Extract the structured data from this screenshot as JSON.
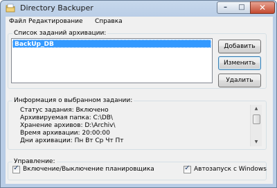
{
  "window": {
    "title": "Directory Backuper",
    "minimize_glyph": "–",
    "maximize_glyph": "□",
    "close_glyph": "✕"
  },
  "menu": {
    "items": [
      {
        "label": "Файл"
      },
      {
        "label": "Редактирование"
      },
      {
        "label": "Справка"
      }
    ]
  },
  "jobs_group": {
    "label": "Список заданий архивации:",
    "items": [
      {
        "label": "BackUp_DB",
        "selected": true
      }
    ],
    "buttons": {
      "add": "Добавить",
      "edit": "Изменить",
      "delete": "Удалить"
    }
  },
  "info_group": {
    "label": "Информация о выбранном задании:",
    "lines": [
      "Статус задания: Включено",
      "Архивируемая папка: C:\\DB\\",
      "Хранение архивов: D:\\Archiv\\",
      "Время архивации: 20:00:00",
      "Дни архивации: Пн Вт Ср Чт Пт"
    ]
  },
  "control_group": {
    "label": "Управление:",
    "scheduler_toggle": {
      "label": "Включение/Выключение планировщика",
      "checked": true
    },
    "autostart": {
      "label": "Автозапуск с Windows",
      "checked": true
    }
  },
  "icons": {
    "app": "folder-icon",
    "scroll_up": "scroll-up-arrow-icon",
    "scroll_down": "scroll-down-arrow-icon"
  },
  "colors": {
    "selection": "#3399ff",
    "titlebar": "#b9cde6",
    "close_button": "#c44a30"
  }
}
